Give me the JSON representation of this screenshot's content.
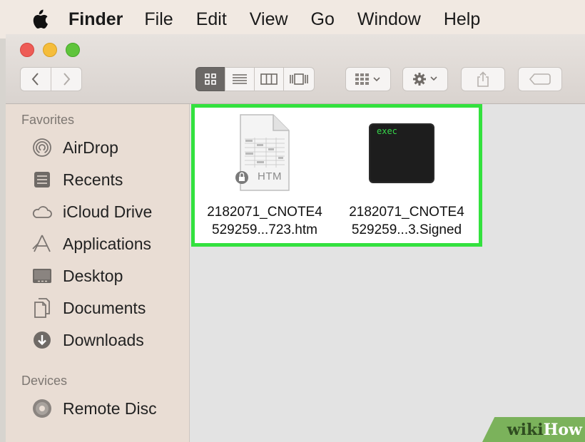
{
  "menubar": {
    "app_name": "Finder",
    "items": [
      "File",
      "Edit",
      "View",
      "Go",
      "Window",
      "Help"
    ]
  },
  "sidebar": {
    "favorites_heading": "Favorites",
    "favorites": [
      {
        "label": "AirDrop",
        "icon": "airdrop-icon"
      },
      {
        "label": "Recents",
        "icon": "recents-icon"
      },
      {
        "label": "iCloud Drive",
        "icon": "cloud-icon"
      },
      {
        "label": "Applications",
        "icon": "applications-icon"
      },
      {
        "label": "Desktop",
        "icon": "desktop-icon"
      },
      {
        "label": "Documents",
        "icon": "documents-icon"
      },
      {
        "label": "Downloads",
        "icon": "downloads-icon"
      }
    ],
    "devices_heading": "Devices",
    "devices": [
      {
        "label": "Remote Disc",
        "icon": "disc-icon"
      }
    ]
  },
  "files": [
    {
      "name_line1": "2182071_CNOTE4",
      "name_line2": "529259...723.htm",
      "icon": "htm-document-icon",
      "badge": "HTM"
    },
    {
      "name_line1": "2182071_CNOTE4",
      "name_line2": "529259...3.Signed",
      "icon": "terminal-exec-icon",
      "badge": "exec"
    }
  ],
  "watermark": {
    "part1": "wiki",
    "part2": "How"
  },
  "colors": {
    "highlight": "#33e13e",
    "menubar": "#f1e9e2",
    "sidebar": "#e9ddd4"
  }
}
